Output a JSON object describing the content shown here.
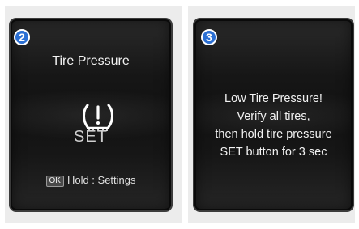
{
  "left_screen": {
    "step": "2",
    "title": "Tire Pressure",
    "icon": "tpms-warning-icon",
    "set_label": "SET",
    "hint_key": "OK",
    "hint_text": "Hold : Settings"
  },
  "right_screen": {
    "step": "3",
    "message_lines": [
      "Low Tire Pressure!",
      "Verify all tires,",
      "then hold tire pressure",
      "SET button for 3 sec"
    ]
  },
  "colors": {
    "badge": "#2b6fd3",
    "screen_bg": "#141414",
    "text": "#f2f2f2",
    "panel_bg": "#ececec"
  }
}
